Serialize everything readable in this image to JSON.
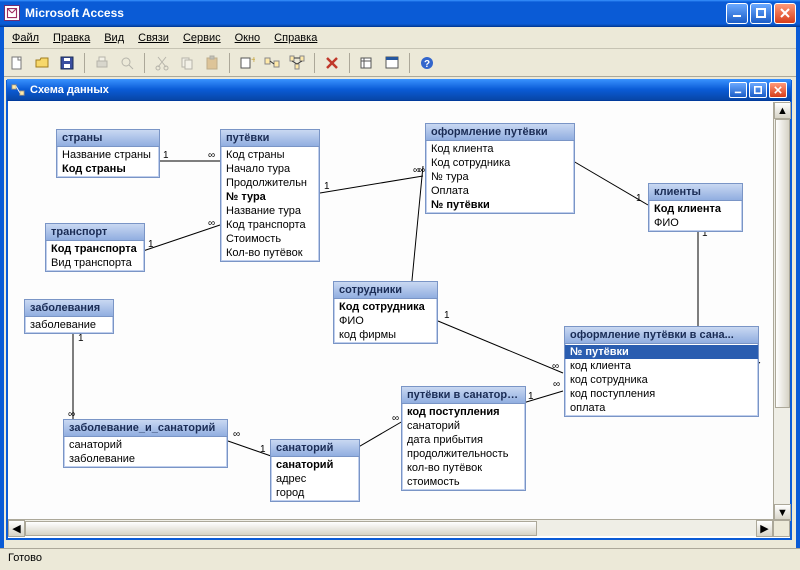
{
  "app": {
    "title": "Microsoft Access"
  },
  "menu": [
    "Файл",
    "Правка",
    "Вид",
    "Связи",
    "Сервис",
    "Окно",
    "Справка"
  ],
  "child_window": {
    "title": "Схема данных"
  },
  "status": "Готово",
  "tables": {
    "countries": {
      "title": "страны",
      "fields": [
        "Название страны",
        "Код страны"
      ],
      "bold": [
        "Код страны"
      ]
    },
    "transport": {
      "title": "транспорт",
      "fields": [
        "Код транспорта",
        "Вид транспорта"
      ],
      "bold": [
        "Код транспорта"
      ]
    },
    "diseases": {
      "title": "заболевания",
      "fields": [
        "заболевание"
      ],
      "bold": []
    },
    "vouchers": {
      "title": "путёвки",
      "fields": [
        "Код страны",
        "Начало тура",
        "Продолжительн",
        "№ тура",
        "Название тура",
        "Код транспорта",
        "Стоимость",
        "Кол-во путёвок"
      ],
      "bold": [
        "№ тура"
      ]
    },
    "staff": {
      "title": "сотрудники",
      "fields": [
        "Код сотрудника",
        "ФИО",
        "код фирмы"
      ],
      "bold": [
        "Код сотрудника"
      ]
    },
    "booking": {
      "title": "оформление путёвки",
      "fields": [
        "Код клиента",
        "Код сотрудника",
        "№ тура",
        "Оплата",
        "№ путёвки"
      ],
      "bold": [
        "№ путёвки"
      ]
    },
    "clients": {
      "title": "клиенты",
      "fields": [
        "Код клиента",
        "ФИО"
      ],
      "bold": [
        "Код клиента"
      ]
    },
    "dis_san": {
      "title": "заболевание_и_санаторий",
      "fields": [
        "санаторий",
        "заболевание"
      ],
      "bold": []
    },
    "sanatorium": {
      "title": "санаторий",
      "fields": [
        "санаторий",
        "адрес",
        "город"
      ],
      "bold": [
        "санаторий"
      ]
    },
    "san_vouchers": {
      "title": "путёвки в санаторий",
      "fields": [
        "код поступления",
        "санаторий",
        "дата прибытия",
        "продолжительность",
        "кол-во путёвок",
        "стоимость"
      ],
      "bold": [
        "код поступления"
      ]
    },
    "san_booking": {
      "title": "оформление путёвки в сана...",
      "fields": [
        "№ путёвки",
        "код клиента",
        "код сотрудника",
        "код поступления",
        "оплата"
      ],
      "bold": [],
      "selected": [
        "№ путёвки"
      ]
    }
  },
  "relationships": [
    {
      "from": "countries",
      "to": "vouchers",
      "cardinality": "1:∞"
    },
    {
      "from": "transport",
      "to": "vouchers",
      "cardinality": "1:∞"
    },
    {
      "from": "vouchers",
      "to": "booking",
      "cardinality": "1:∞"
    },
    {
      "from": "staff",
      "to": "booking",
      "cardinality": "1:∞"
    },
    {
      "from": "clients",
      "to": "booking",
      "cardinality": "1:∞"
    },
    {
      "from": "diseases",
      "to": "dis_san",
      "cardinality": "1:∞"
    },
    {
      "from": "sanatorium",
      "to": "dis_san",
      "cardinality": "1:∞"
    },
    {
      "from": "sanatorium",
      "to": "san_vouchers",
      "cardinality": "1:∞"
    },
    {
      "from": "san_vouchers",
      "to": "san_booking",
      "cardinality": "1:∞"
    },
    {
      "from": "clients",
      "to": "san_booking",
      "cardinality": "1:∞"
    },
    {
      "from": "staff",
      "to": "san_booking",
      "cardinality": "1:∞"
    }
  ]
}
